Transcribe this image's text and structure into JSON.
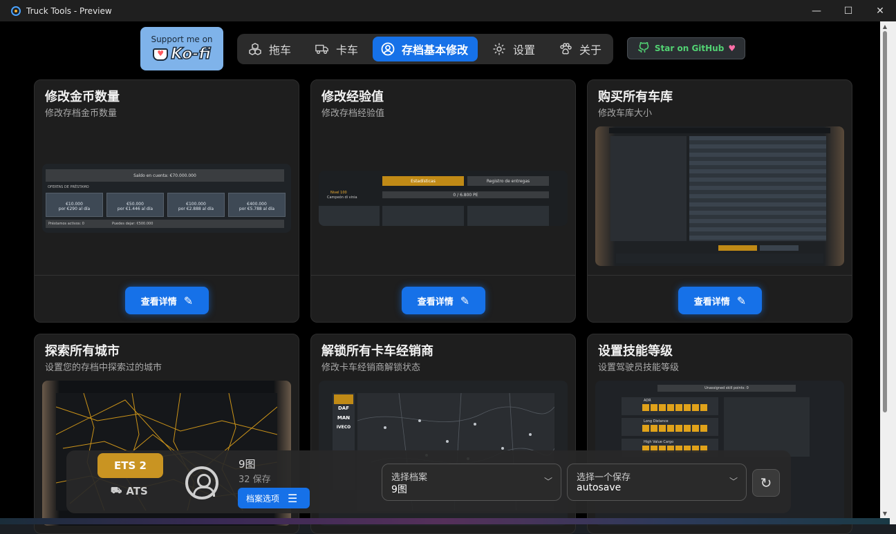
{
  "window": {
    "title": "Truck Tools - Preview",
    "controls": {
      "minimize": "—",
      "maximize": "☐",
      "close": "✕"
    }
  },
  "colors": {
    "accent": "#1671e8",
    "gold": "#f2b134",
    "github_green": "#52d273"
  },
  "kofi": {
    "support": "Support me on",
    "brand": "Ko-fi"
  },
  "nav": {
    "items": [
      {
        "label": "拖车",
        "icon": "cubes-icon"
      },
      {
        "label": "卡车",
        "icon": "truck-icon"
      },
      {
        "label": "存档基本修改",
        "icon": "user-circle-icon",
        "active": true
      },
      {
        "label": "设置",
        "icon": "gear-icon"
      },
      {
        "label": "关于",
        "icon": "paw-icon"
      }
    ]
  },
  "github": {
    "label": "Star on GitHub"
  },
  "cards": [
    {
      "title": "修改金币数量",
      "subtitle": "修改存档金币数量",
      "button": "查看详情",
      "shot": {
        "balance": "Saldo en cuenta: €70.000.000",
        "section": "OFERTAS DE PRÉSTAMO",
        "loans": [
          [
            "€10.000",
            "por €290 al día"
          ],
          [
            "€50.000",
            "por €1.446 al día"
          ],
          [
            "€100.000",
            "por €2.888 al día"
          ],
          [
            "€400.000",
            "por €5.788 al día"
          ]
        ],
        "active": "Préstamos activos: 0",
        "can": "Puedes dejar: €500.000"
      }
    },
    {
      "title": "修改经验值",
      "subtitle": "修改存档经验值",
      "button": "查看详情",
      "shot": {
        "tab1": "Estadísticas",
        "tab2": "Registro de entregas",
        "level": "Nivel 100",
        "rank": "Campeón di vinia",
        "xp": "0 / 6.800 PE"
      }
    },
    {
      "title": "购买所有车库",
      "subtitle": "修改车库大小",
      "button": "查看详情"
    },
    {
      "title": "探索所有城市",
      "subtitle": "设置您的存档中探索过的城市"
    },
    {
      "title": "解锁所有卡车经销商",
      "subtitle": "修改卡车经销商解锁状态",
      "shot": {
        "brands": [
          "DAF",
          "MAN",
          "IVECO"
        ]
      }
    },
    {
      "title": "设置技能等级",
      "subtitle": "设置驾驶员技能等级",
      "shot": {
        "points": "Unassigned skill points: 0",
        "skills": [
          "ADR",
          "Long Distance",
          "High Value Cargo"
        ]
      }
    }
  ],
  "profile": {
    "games": {
      "ets": "ETS 2",
      "ats": "ATS"
    },
    "name": "9图",
    "saves": "32 保存",
    "options_button": "档案选项"
  },
  "select_profile": {
    "label": "选择档案",
    "value": "9图"
  },
  "select_save": {
    "label": "选择一个保存",
    "value": "autosave"
  }
}
